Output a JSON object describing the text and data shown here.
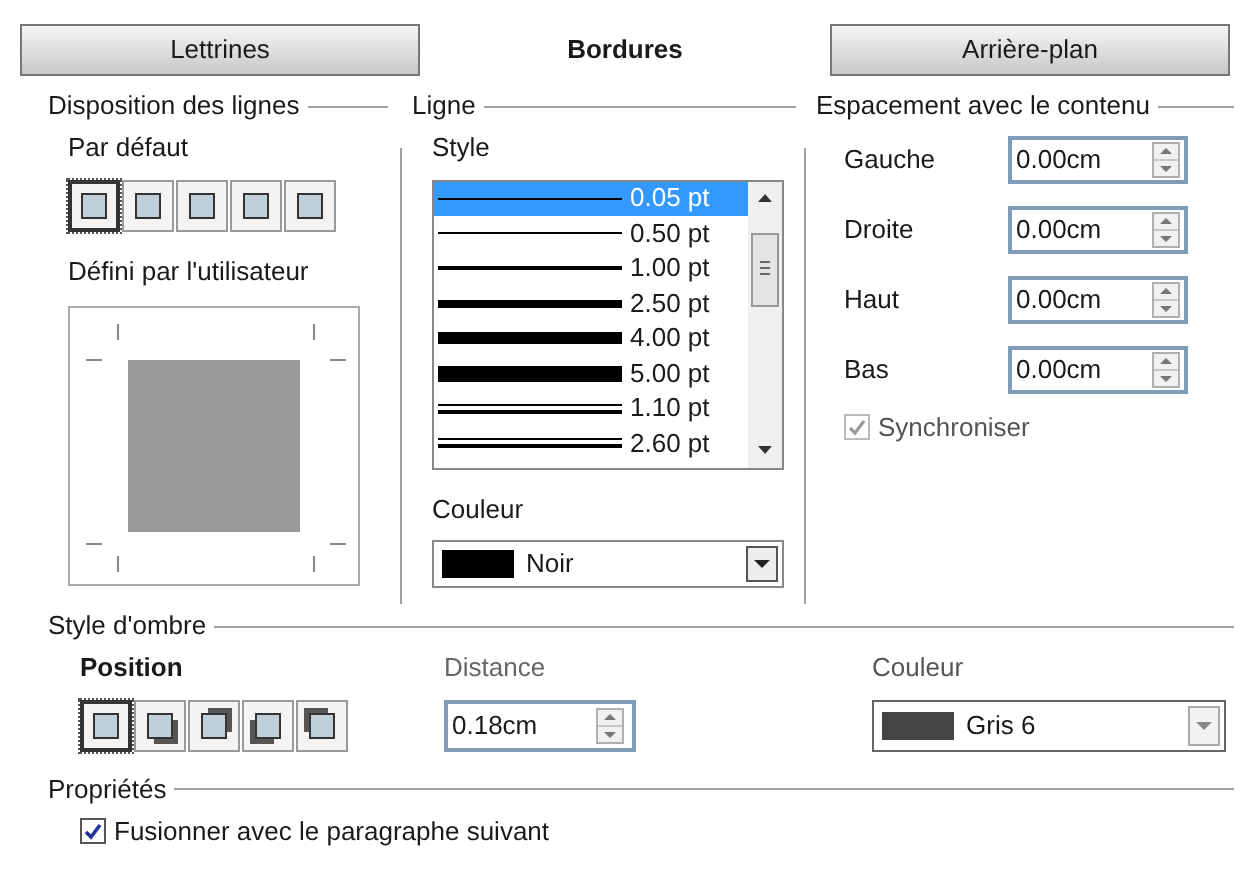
{
  "tabs": [
    {
      "label": "Lettrines",
      "selected": false
    },
    {
      "label": "Bordures",
      "selected": true
    },
    {
      "label": "Arrière-plan",
      "selected": false
    }
  ],
  "line_arrangement": {
    "title": "Disposition des lignes",
    "default_label": "Par défaut",
    "presets": [
      {
        "selected": true
      },
      {
        "selected": false
      },
      {
        "selected": false
      },
      {
        "selected": false
      },
      {
        "selected": false
      }
    ],
    "user_defined_label": "Défini par l'utilisateur"
  },
  "line": {
    "title": "Ligne",
    "style_label": "Style",
    "styles": [
      {
        "kind": "hairline",
        "label": "0.05 pt",
        "selected": true
      },
      {
        "kind": "thin",
        "label": "0.50 pt",
        "selected": false
      },
      {
        "kind": "medium",
        "label": "1.00 pt",
        "selected": false
      },
      {
        "kind": "thick",
        "label": "2.50 pt",
        "selected": false
      },
      {
        "kind": "heavy",
        "label": "4.00 pt",
        "selected": false
      },
      {
        "kind": "heavier",
        "label": "5.00 pt",
        "selected": false
      },
      {
        "kind": "double",
        "label": "1.10 pt",
        "selected": false
      },
      {
        "kind": "double",
        "label": "2.60 pt",
        "selected": false
      }
    ],
    "color_label": "Couleur",
    "color": {
      "name": "Noir",
      "color": "#000000"
    }
  },
  "spacing": {
    "title": "Espacement avec le contenu",
    "fields": [
      {
        "label": "Gauche",
        "value": "0.00cm"
      },
      {
        "label": "Droite",
        "value": "0.00cm"
      },
      {
        "label": "Haut",
        "value": "0.00cm"
      },
      {
        "label": "Bas",
        "value": "0.00cm"
      }
    ],
    "synchronize": {
      "label": "Synchroniser",
      "checked": true,
      "disabled": true
    }
  },
  "shadow": {
    "title": "Style d'ombre",
    "position_label": "Position",
    "positions": [
      {
        "kind": "none",
        "selected": true
      },
      {
        "kind": "bottom-right",
        "selected": false
      },
      {
        "kind": "top-right",
        "selected": false
      },
      {
        "kind": "bottom-left",
        "selected": false
      },
      {
        "kind": "top-left",
        "selected": false
      }
    ],
    "distance_label": "Distance",
    "distance": "0.18cm",
    "color_label": "Couleur",
    "color": {
      "name": "Gris 6",
      "color": "#444444"
    }
  },
  "properties": {
    "title": "Propriétés",
    "merge": {
      "label": "Fusionner avec le paragraphe suivant",
      "checked": true
    }
  }
}
